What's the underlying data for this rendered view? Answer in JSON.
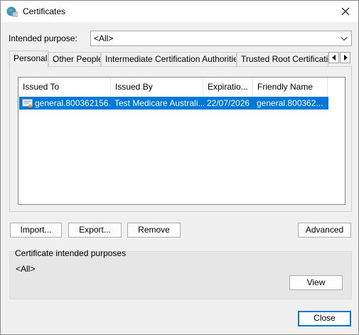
{
  "window": {
    "title": "Certificates",
    "app_icon": "certificate-manager-icon",
    "close_icon": "close-icon"
  },
  "purpose": {
    "label": "Intended purpose:",
    "value": "<All>"
  },
  "tabs": [
    {
      "label": "Personal",
      "active": true
    },
    {
      "label": "Other People",
      "active": false
    },
    {
      "label": "Intermediate Certification Authorities",
      "active": false
    },
    {
      "label": "Trusted Root Certification",
      "active": false
    }
  ],
  "table": {
    "columns": [
      "Issued To",
      "Issued By",
      "Expiratio...",
      "Friendly Name"
    ],
    "rows": [
      {
        "issued_to": "general.800362156...",
        "issued_by": "Test Medicare Australi...",
        "expiration": "22/07/2026",
        "friendly_name": "general.800362...",
        "selected": true
      }
    ]
  },
  "buttons": {
    "import": "Import...",
    "export": "Export...",
    "remove": "Remove",
    "advanced": "Advanced",
    "view": "View",
    "close": "Close"
  },
  "purposes_group": {
    "title": "Certificate intended purposes",
    "value": "<All>"
  },
  "colors": {
    "selection": "#0078d7",
    "dialog_bg": "#f0f0f0"
  }
}
